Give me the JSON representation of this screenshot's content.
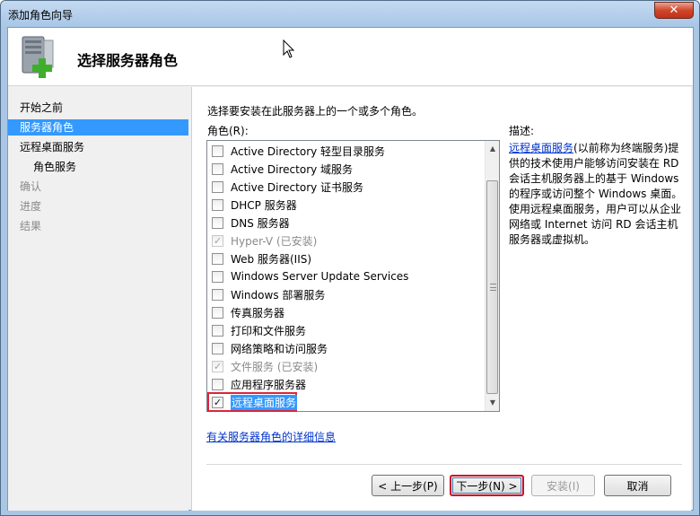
{
  "window": {
    "title": "添加角色向导",
    "close_label": "✕"
  },
  "header": {
    "title": "选择服务器角色"
  },
  "nav": {
    "items": [
      {
        "label": "开始之前",
        "state": "normal"
      },
      {
        "label": "服务器角色",
        "state": "selected"
      },
      {
        "label": "远程桌面服务",
        "state": "normal"
      },
      {
        "label": "角色服务",
        "state": "normal"
      },
      {
        "label": "确认",
        "state": "disabled"
      },
      {
        "label": "进度",
        "state": "disabled"
      },
      {
        "label": "结果",
        "state": "disabled"
      }
    ]
  },
  "main": {
    "instruction": "选择要安装在此服务器上的一个或多个角色。",
    "roles_label": "角色(R):",
    "description_label": "描述:",
    "roles": [
      {
        "label": "Active Directory 轻型目录服务",
        "checked": false,
        "disabled": false
      },
      {
        "label": "Active Directory 域服务",
        "checked": false,
        "disabled": false
      },
      {
        "label": "Active Directory 证书服务",
        "checked": false,
        "disabled": false
      },
      {
        "label": "DHCP 服务器",
        "checked": false,
        "disabled": false
      },
      {
        "label": "DNS 服务器",
        "checked": false,
        "disabled": false
      },
      {
        "label": "Hyper-V  (已安装)",
        "checked": true,
        "disabled": true
      },
      {
        "label": "Web 服务器(IIS)",
        "checked": false,
        "disabled": false
      },
      {
        "label": "Windows Server Update Services",
        "checked": false,
        "disabled": false
      },
      {
        "label": "Windows 部署服务",
        "checked": false,
        "disabled": false
      },
      {
        "label": "传真服务器",
        "checked": false,
        "disabled": false
      },
      {
        "label": "打印和文件服务",
        "checked": false,
        "disabled": false
      },
      {
        "label": "网络策略和访问服务",
        "checked": false,
        "disabled": false
      },
      {
        "label": "文件服务  (已安装)",
        "checked": true,
        "disabled": true
      },
      {
        "label": "应用程序服务器",
        "checked": false,
        "disabled": false
      },
      {
        "label": "远程桌面服务",
        "checked": true,
        "disabled": false
      }
    ],
    "description": {
      "link_text": "远程桌面服务",
      "text": "(以前称为终端服务)提供的技术使用户能够访问安装在 RD 会话主机服务器上的基于 Windows 的程序或访问整个 Windows 桌面。使用远程桌面服务，用户可以从企业网络或 Internet 访问 RD 会话主机服务器或虚拟机。"
    },
    "more_info_link": "有关服务器角色的详细信息"
  },
  "buttons": {
    "back": "< 上一步(P)",
    "next": "下一步(N) >",
    "install": "安装(I)",
    "cancel": "取消"
  },
  "icons": {
    "header_icon": "server-add-icon",
    "cursor": "mouse-cursor-icon"
  }
}
